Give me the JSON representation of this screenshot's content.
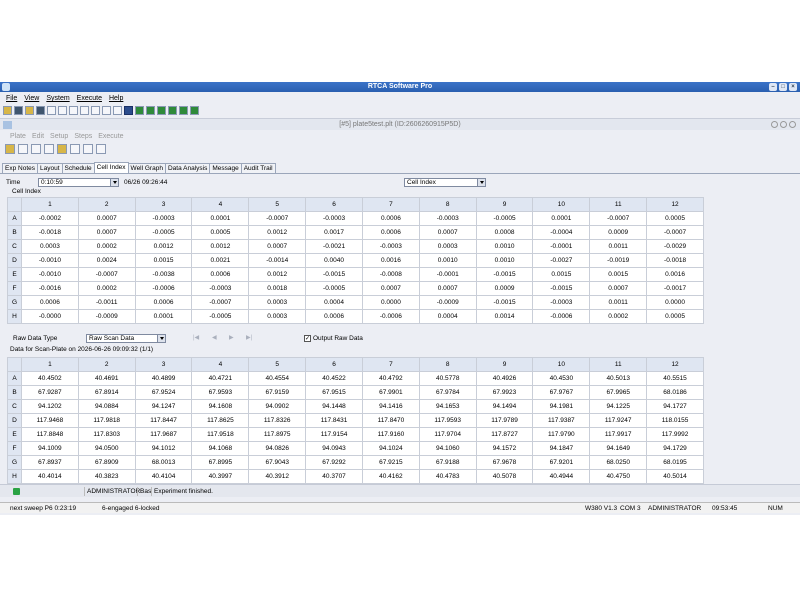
{
  "window": {
    "title": "RTCA Software Pro"
  },
  "menu": [
    "File",
    "View",
    "System",
    "Execute",
    "Help"
  ],
  "document": {
    "title": "[#5] plate5test.plt (ID:2606260915P5D)"
  },
  "submenu": [
    "Plate",
    "Edit",
    "Setup",
    "Steps",
    "Execute"
  ],
  "tabs": [
    "Exp Notes",
    "Layout",
    "Schedule",
    "Cell Index",
    "Well Graph",
    "Data Analysis",
    "Message",
    "Audit Trail"
  ],
  "active_tab": "Cell Index",
  "time": {
    "label": "Time",
    "value": "0:10:59",
    "datetime": "06/26 09:26:44"
  },
  "cell_index": {
    "selector": "Cell Index",
    "group_label": "Cell Index",
    "columns": [
      "1",
      "2",
      "3",
      "4",
      "5",
      "6",
      "7",
      "8",
      "9",
      "10",
      "11",
      "12"
    ],
    "rows": [
      {
        "label": "A",
        "values": [
          "-0.0002",
          "0.0007",
          "-0.0003",
          "0.0001",
          "-0.0007",
          "-0.0003",
          "0.0006",
          "-0.0003",
          "-0.0005",
          "0.0001",
          "-0.0007",
          "0.0005"
        ]
      },
      {
        "label": "B",
        "values": [
          "-0.0018",
          "0.0007",
          "-0.0005",
          "0.0005",
          "0.0012",
          "0.0017",
          "0.0006",
          "0.0007",
          "0.0008",
          "-0.0004",
          "0.0009",
          "-0.0007"
        ]
      },
      {
        "label": "C",
        "values": [
          "0.0003",
          "0.0002",
          "0.0012",
          "0.0012",
          "0.0007",
          "-0.0021",
          "-0.0003",
          "0.0003",
          "0.0010",
          "-0.0001",
          "0.0011",
          "-0.0029"
        ]
      },
      {
        "label": "D",
        "values": [
          "-0.0010",
          "0.0024",
          "0.0015",
          "0.0021",
          "-0.0014",
          "0.0040",
          "0.0016",
          "0.0010",
          "0.0010",
          "-0.0027",
          "-0.0019",
          "-0.0018"
        ]
      },
      {
        "label": "E",
        "values": [
          "-0.0010",
          "-0.0007",
          "-0.0038",
          "0.0006",
          "0.0012",
          "-0.0015",
          "-0.0008",
          "-0.0001",
          "-0.0015",
          "0.0015",
          "0.0015",
          "0.0016"
        ]
      },
      {
        "label": "F",
        "values": [
          "-0.0016",
          "0.0002",
          "-0.0006",
          "-0.0003",
          "0.0018",
          "-0.0005",
          "0.0007",
          "0.0007",
          "0.0009",
          "-0.0015",
          "0.0007",
          "-0.0017"
        ]
      },
      {
        "label": "G",
        "values": [
          "0.0006",
          "-0.0011",
          "0.0006",
          "-0.0007",
          "0.0003",
          "0.0004",
          "0.0000",
          "-0.0009",
          "-0.0015",
          "-0.0003",
          "0.0011",
          "0.0000"
        ]
      },
      {
        "label": "H",
        "values": [
          "-0.0000",
          "-0.0009",
          "0.0001",
          "-0.0005",
          "0.0003",
          "0.0006",
          "-0.0006",
          "0.0004",
          "0.0014",
          "-0.0006",
          "0.0002",
          "0.0005"
        ]
      }
    ]
  },
  "raw": {
    "type_label": "Raw Data Type",
    "type_value": "Raw Scan Data",
    "output_label": "Output Raw Data",
    "output_checked": "✓",
    "scan_label": "Data for Scan-Plate on 2026-06-26 09:09:32 (1/1)",
    "columns": [
      "1",
      "2",
      "3",
      "4",
      "5",
      "6",
      "7",
      "8",
      "9",
      "10",
      "11",
      "12"
    ],
    "rows": [
      {
        "label": "A",
        "values": [
          "40.4502",
          "40.4691",
          "40.4899",
          "40.4721",
          "40.4554",
          "40.4522",
          "40.4792",
          "40.5778",
          "40.4926",
          "40.4530",
          "40.5013",
          "40.5515"
        ]
      },
      {
        "label": "B",
        "values": [
          "67.9287",
          "67.8914",
          "67.9524",
          "67.9593",
          "67.9159",
          "67.9515",
          "67.9901",
          "67.9784",
          "67.9923",
          "67.9767",
          "67.9965",
          "68.0186"
        ]
      },
      {
        "label": "C",
        "values": [
          "94.1202",
          "94.0884",
          "94.1247",
          "94.1608",
          "94.0902",
          "94.1448",
          "94.1416",
          "94.1653",
          "94.1494",
          "94.1981",
          "94.1225",
          "94.1727"
        ]
      },
      {
        "label": "D",
        "values": [
          "117.9468",
          "117.9818",
          "117.8447",
          "117.8625",
          "117.8326",
          "117.8431",
          "117.8470",
          "117.9593",
          "117.9789",
          "117.9387",
          "117.9247",
          "118.0155"
        ]
      },
      {
        "label": "E",
        "values": [
          "117.8848",
          "117.8303",
          "117.9687",
          "117.9518",
          "117.8975",
          "117.9154",
          "117.9160",
          "117.9704",
          "117.8727",
          "117.9790",
          "117.9917",
          "117.9992"
        ]
      },
      {
        "label": "F",
        "values": [
          "94.1009",
          "94.0500",
          "94.1012",
          "94.1068",
          "94.0826",
          "94.0943",
          "94.1024",
          "94.1060",
          "94.1572",
          "94.1847",
          "94.1649",
          "94.1729"
        ]
      },
      {
        "label": "G",
        "values": [
          "67.8937",
          "67.8909",
          "68.0013",
          "67.8995",
          "67.9043",
          "67.9292",
          "67.9215",
          "67.9188",
          "67.9678",
          "67.9201",
          "68.0250",
          "68.0195"
        ]
      },
      {
        "label": "H",
        "values": [
          "40.4014",
          "40.3823",
          "40.4104",
          "40.3997",
          "40.3912",
          "40.3707",
          "40.4162",
          "40.4783",
          "40.5078",
          "40.4944",
          "40.4750",
          "40.5014"
        ]
      }
    ]
  },
  "status_row": {
    "user": "ADMINISTRATOR",
    "mode": "Bas",
    "message": "Experiment finished."
  },
  "statusbar": {
    "sweep": "next sweep P6  0:23:19",
    "engaged": "6-engaged  6-locked",
    "version": "W380 V1.3",
    "port": "COM 3",
    "user": "ADMINISTRATOR",
    "time": "09:53:45",
    "num": "NUM"
  },
  "colors": {
    "title_blue": "#2a5fb0",
    "header_bg": "#dfe6f2",
    "lock_green": "#2aa344"
  }
}
